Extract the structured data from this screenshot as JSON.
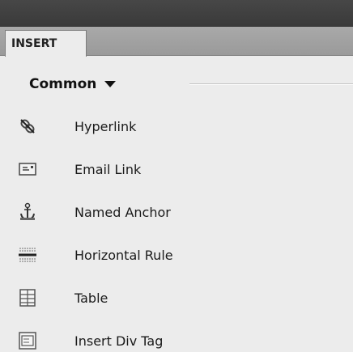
{
  "panel": {
    "tab_label": "INSERT",
    "category": "Common",
    "items": [
      {
        "label": "Hyperlink",
        "icon": "hyperlink-icon"
      },
      {
        "label": "Email Link",
        "icon": "email-link-icon"
      },
      {
        "label": "Named Anchor",
        "icon": "named-anchor-icon"
      },
      {
        "label": "Horizontal Rule",
        "icon": "horizontal-rule-icon"
      },
      {
        "label": "Table",
        "icon": "table-icon"
      },
      {
        "label": "Insert Div Tag",
        "icon": "div-tag-icon"
      }
    ]
  },
  "colors": {
    "titlebar": "#3f3f3f",
    "tabstrip": "#a3a3a3",
    "panel_bg": "#ececec",
    "text": "#1a1a1a"
  }
}
